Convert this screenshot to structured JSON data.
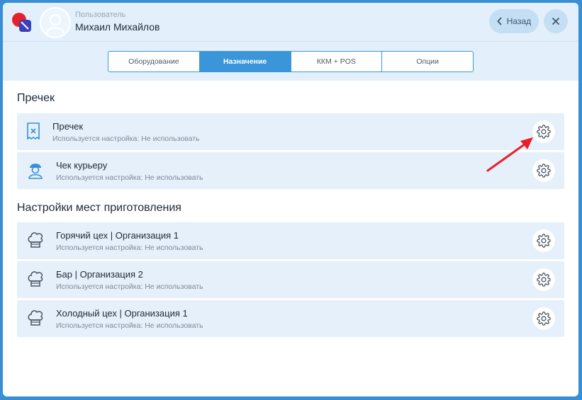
{
  "header": {
    "user_role": "Пользователь",
    "user_name": "Михаил Михайлов",
    "back_label": "Назад"
  },
  "tabs": [
    {
      "label": "Оборудование",
      "active": false
    },
    {
      "label": "Назначение",
      "active": true
    },
    {
      "label": "ККМ + POS",
      "active": false
    },
    {
      "label": "Опции",
      "active": false
    }
  ],
  "sections": [
    {
      "title": "Пречек",
      "rows": [
        {
          "title": "Пречек",
          "subtitle": "Используется настройка: Не использовать",
          "icon": "receipt-icon"
        },
        {
          "title": "Чек курьеру",
          "subtitle": "Используется настройка: Не использовать",
          "icon": "courier-icon"
        }
      ]
    },
    {
      "title": "Настройки мест приготовления",
      "rows": [
        {
          "title": "Горячий цех | Организация 1",
          "subtitle": "Используется настройка: Не использовать",
          "icon": "chef-hat-icon"
        },
        {
          "title": "Бар | Организация 2",
          "subtitle": "Используется настройка: Не использовать",
          "icon": "chef-hat-icon"
        },
        {
          "title": "Холодный цех | Организация 1",
          "subtitle": "Используется настройка: Не использовать",
          "icon": "chef-hat-icon"
        }
      ]
    }
  ],
  "colors": {
    "accent": "#3a96d8",
    "header_bg": "#e3f0fb",
    "row_bg": "#e5f0fa",
    "annotation_arrow": "#e8202a"
  }
}
